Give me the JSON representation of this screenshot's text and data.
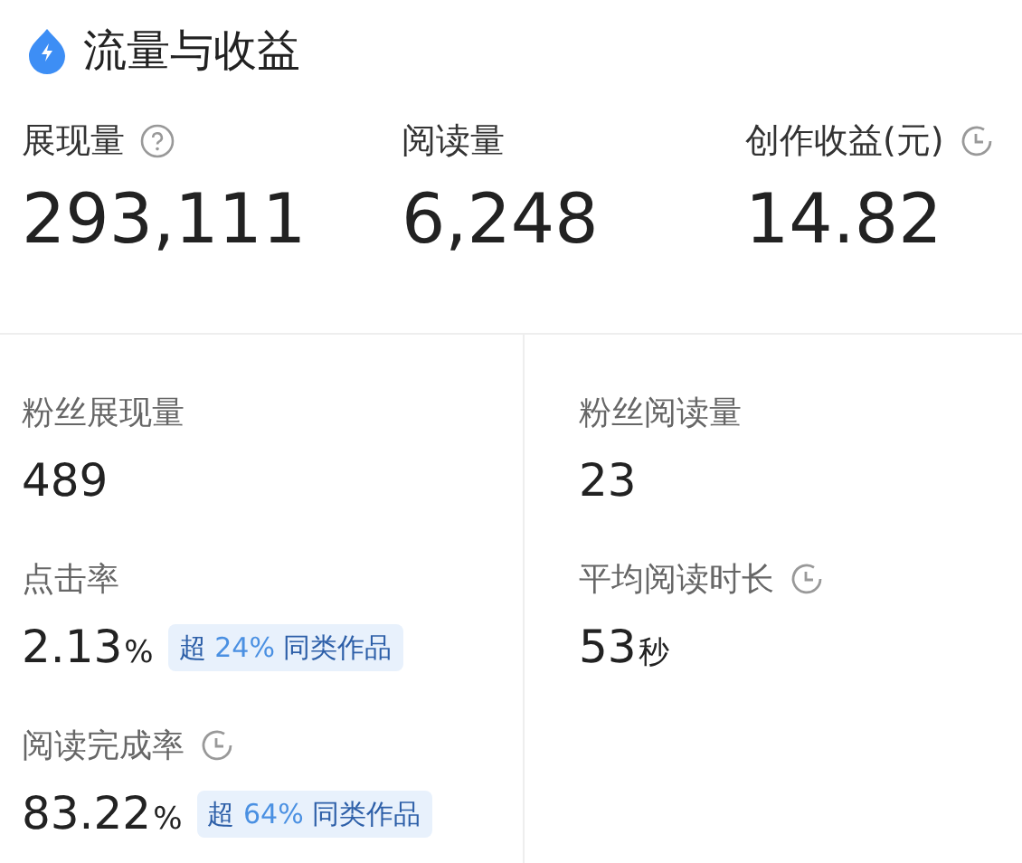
{
  "header": {
    "title": "流量与收益"
  },
  "top_metrics": [
    {
      "label": "展现量",
      "kind": "help",
      "value": "293,111"
    },
    {
      "label": "阅读量",
      "value": "6,248"
    },
    {
      "label": "创作收益(元)",
      "kind": "timed",
      "value": "14.82"
    }
  ],
  "left_metrics": [
    {
      "label": "粉丝展现量",
      "value": "489"
    },
    {
      "label": "点击率",
      "value": "2.13",
      "unit": "%",
      "badge": {
        "prefix": "超",
        "highlight": "24%",
        "suffix": "同类作品"
      }
    },
    {
      "label": "阅读完成率",
      "kind": "timed",
      "value": "83.22",
      "unit": "%",
      "badge": {
        "prefix": "超",
        "highlight": "64%",
        "suffix": "同类作品"
      }
    }
  ],
  "right_metrics": [
    {
      "label": "粉丝阅读量",
      "value": "23"
    },
    {
      "label": "平均阅读时长",
      "kind": "timed",
      "value": "53",
      "unit": "秒"
    }
  ]
}
